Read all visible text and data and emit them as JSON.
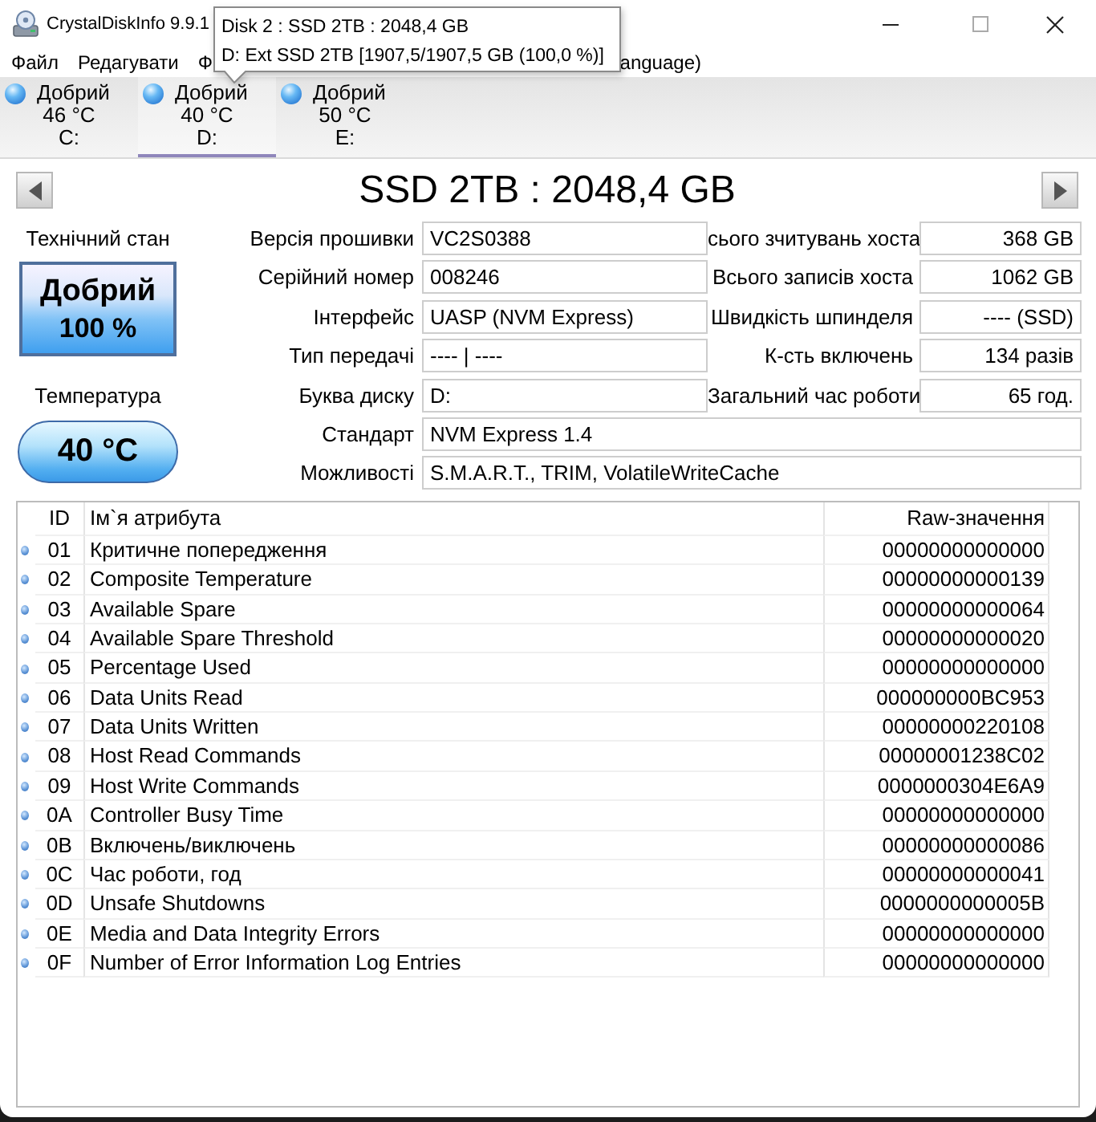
{
  "window": {
    "title": "CrystalDiskInfo 9.9.1"
  },
  "menu": [
    "Файл",
    "Редагувати",
    "Ф",
    "anguage)"
  ],
  "tooltip": {
    "lines": [
      "Disk 2 : SSD 2TB : 2048,4 GB",
      "D: Ext SSD 2TB [1907,5/1907,5 GB (100,0 %)]"
    ]
  },
  "disks": [
    {
      "status": "Добрий",
      "temperature": "46 °C",
      "letter": "C:",
      "selected": false
    },
    {
      "status": "Добрий",
      "temperature": "40 °C",
      "letter": "D:",
      "selected": true
    },
    {
      "status": "Добрий",
      "temperature": "50 °C",
      "letter": "E:",
      "selected": false
    }
  ],
  "disk_title": "SSD 2TB : 2048,4 GB",
  "health": {
    "label": "Технічний стан",
    "status": "Добрий",
    "percent": "100 %"
  },
  "temperature": {
    "label": "Температура",
    "value": "40 °C"
  },
  "details": [
    {
      "label": "Версія прошивки",
      "value": "VC2S0388"
    },
    {
      "label": "Серійний номер",
      "value": "008246"
    },
    {
      "label": "Інтерфейс",
      "value": "UASP (NVM Express)"
    },
    {
      "label": "Тип передачі",
      "value": "---- | ----"
    },
    {
      "label": "Буква диску",
      "value": "D:"
    },
    {
      "label": "Стандарт",
      "value": "NVM Express 1.4"
    },
    {
      "label": "Можливості",
      "value": "S.M.A.R.T., TRIM, VolatileWriteCache"
    }
  ],
  "host_stats": [
    {
      "label": "сього зчитувань хоста",
      "value": "368 GB"
    },
    {
      "label": "Всього записів хоста",
      "value": "1062 GB"
    },
    {
      "label": "Швидкість шпинделя",
      "value": "---- (SSD)"
    },
    {
      "label": "К-сть включень",
      "value": "134 разів"
    },
    {
      "label": "Загальний час роботи",
      "value": "65 год."
    }
  ],
  "smart_table": {
    "columns": [
      "ID",
      "Ім`я атрибута",
      "Raw-значення"
    ],
    "rows": [
      {
        "id": "01",
        "name": "Критичне попередження",
        "raw": "00000000000000"
      },
      {
        "id": "02",
        "name": "Composite Temperature",
        "raw": "00000000000139"
      },
      {
        "id": "03",
        "name": "Available Spare",
        "raw": "00000000000064"
      },
      {
        "id": "04",
        "name": "Available Spare Threshold",
        "raw": "00000000000020"
      },
      {
        "id": "05",
        "name": "Percentage Used",
        "raw": "00000000000000"
      },
      {
        "id": "06",
        "name": "Data Units Read",
        "raw": "000000000BC953"
      },
      {
        "id": "07",
        "name": "Data Units Written",
        "raw": "00000000220108"
      },
      {
        "id": "08",
        "name": "Host Read Commands",
        "raw": "00000001238C02"
      },
      {
        "id": "09",
        "name": "Host Write Commands",
        "raw": "0000000304E6A9"
      },
      {
        "id": "0A",
        "name": "Controller Busy Time",
        "raw": "00000000000000"
      },
      {
        "id": "0B",
        "name": "Включень/виключень",
        "raw": "00000000000086"
      },
      {
        "id": "0C",
        "name": "Час роботи, год",
        "raw": "00000000000041"
      },
      {
        "id": "0D",
        "name": "Unsafe Shutdowns",
        "raw": "0000000000005B"
      },
      {
        "id": "0E",
        "name": "Media and Data Integrity Errors",
        "raw": "00000000000000"
      },
      {
        "id": "0F",
        "name": "Number of Error Information Log Entries",
        "raw": "00000000000000"
      }
    ]
  }
}
